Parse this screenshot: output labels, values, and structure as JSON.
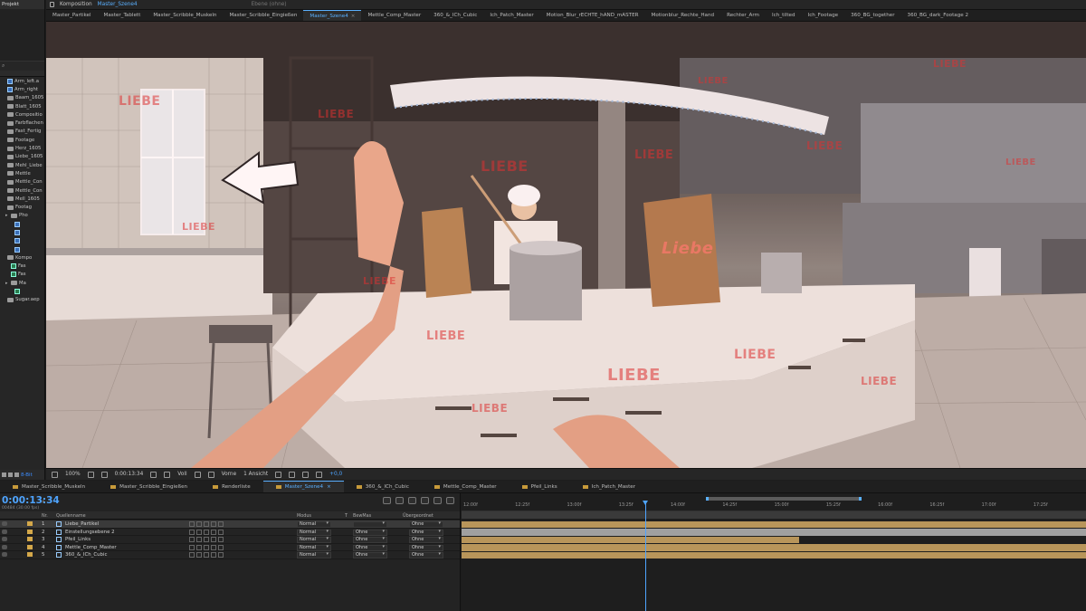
{
  "project": {
    "title": "Projekt",
    "items": [
      {
        "label": "Arm_left.a",
        "type": "footage",
        "indent": 0
      },
      {
        "label": "Arm_right",
        "type": "footage",
        "indent": 0
      },
      {
        "label": "Baam_1605",
        "type": "folder",
        "indent": 0
      },
      {
        "label": "Blatt_1605",
        "type": "folder",
        "indent": 0
      },
      {
        "label": "Compositio",
        "type": "folder",
        "indent": 0
      },
      {
        "label": "Farbflachen",
        "type": "folder",
        "indent": 0
      },
      {
        "label": "Fast_Fertig",
        "type": "folder",
        "indent": 0
      },
      {
        "label": "Footage",
        "type": "folder",
        "indent": 0
      },
      {
        "label": "Herz_1605",
        "type": "folder",
        "indent": 0
      },
      {
        "label": "Liebe_1605",
        "type": "folder",
        "indent": 0
      },
      {
        "label": "Mehl_Liebe",
        "type": "folder",
        "indent": 0
      },
      {
        "label": "Mettle",
        "type": "folder",
        "indent": 0
      },
      {
        "label": "Mettle_Con",
        "type": "folder",
        "indent": 0
      },
      {
        "label": "Mettle_Con",
        "type": "folder",
        "indent": 0
      },
      {
        "label": "Mell_1605",
        "type": "folder",
        "indent": 0
      },
      {
        "label": "Footag",
        "type": "folder",
        "indent": 0
      },
      {
        "label": "Pho",
        "type": "folder",
        "indent": 1
      },
      {
        "label": "",
        "type": "footage",
        "indent": 2
      },
      {
        "label": "",
        "type": "footage",
        "indent": 2
      },
      {
        "label": "",
        "type": "footage",
        "indent": 2
      },
      {
        "label": "",
        "type": "footage",
        "indent": 2
      },
      {
        "label": "Kompo",
        "type": "folder",
        "indent": 0
      },
      {
        "label": "Fas",
        "type": "comp",
        "indent": 1
      },
      {
        "label": "Fas",
        "type": "comp",
        "indent": 1
      },
      {
        "label": "Ma",
        "type": "folder",
        "indent": 1
      },
      {
        "label": "",
        "type": "comp",
        "indent": 2
      },
      {
        "label": "Sugar.aep",
        "type": "folder",
        "indent": 0
      }
    ],
    "footer_bpc": "8-Bit"
  },
  "comp_header": {
    "label": "Komposition",
    "name": "Master_Szene4",
    "layer_panel": "Ebene (ohne)"
  },
  "comp_tabs": [
    {
      "label": "Master_Partikel",
      "active": false
    },
    {
      "label": "Master_Tablett",
      "active": false
    },
    {
      "label": "Master_Scribble_Muskeln",
      "active": false
    },
    {
      "label": "Master_Scribble_Eingießen",
      "active": false
    },
    {
      "label": "Master_Szene4",
      "active": true
    },
    {
      "label": "Mettle_Comp_Master",
      "active": false
    },
    {
      "label": "360_&_ICh_Cubic",
      "active": false
    },
    {
      "label": "Ich_Patch_Master",
      "active": false
    },
    {
      "label": "Motion_Blur_rECHTE_hAND_mASTER",
      "active": false
    },
    {
      "label": "Motionblur_Rechte_Hand",
      "active": false
    },
    {
      "label": "Rechter_Arm",
      "active": false
    },
    {
      "label": "Ich_tilted",
      "active": false
    },
    {
      "label": "Ich_Footage",
      "active": false
    },
    {
      "label": "360_BG_together",
      "active": false
    },
    {
      "label": "360_BG_dark_Footage 2",
      "active": false
    }
  ],
  "viewer": {
    "liebe_texts": [
      "LIEBE",
      "LIEBE",
      "LIEBE",
      "LIEBE",
      "LIEBE",
      "LIEBE",
      "LIEBE",
      "LIEBE",
      "LIEBE",
      "LIEBE",
      "LIEBE",
      "LIEBE",
      "LIEBE",
      "LIEBE",
      "LIEBE"
    ],
    "bag_lettering": "Liebe"
  },
  "viewer_bar": {
    "zoom": "100%",
    "timecode": "0:00:13:34",
    "resolution": "Voll",
    "view": "Vorne",
    "views": "1 Ansicht",
    "exposure": "+0,0"
  },
  "timeline_tabs": [
    {
      "label": "Master_Scribble_Muskeln",
      "active": false
    },
    {
      "label": "Master_Scribble_Eingießen",
      "active": false
    },
    {
      "label": "Renderliste",
      "active": false
    },
    {
      "label": "Master_Szene4",
      "active": true
    },
    {
      "label": "360_&_ICh_Cubic",
      "active": false
    },
    {
      "label": "Mettle_Comp_Master",
      "active": false
    },
    {
      "label": "Pfeil_Links",
      "active": false
    },
    {
      "label": "Ich_Patch_Master",
      "active": false
    }
  ],
  "timeline": {
    "timecode": "0:00:13:34",
    "fps": "00484 (30.00 fps)",
    "columns": {
      "num": "Nr.",
      "source": "Quellenname",
      "mode": "Modus",
      "t": "T",
      "trkmat": "BewMas",
      "parent": "Übergeordnet"
    },
    "layers": [
      {
        "num": "1",
        "name": "Liebe_Partikel",
        "mode": "Normal",
        "trkmat": "",
        "parent": "Ohne",
        "label_color": "#d4a84a",
        "selected": true,
        "bar_color": "#b8955a"
      },
      {
        "num": "2",
        "name": "Einstellungsebene 2",
        "mode": "Normal",
        "trkmat": "Ohne",
        "parent": "Ohne",
        "label_color": "#d4a84a",
        "selected": false,
        "bar_color": "#a0a0a0"
      },
      {
        "num": "3",
        "name": "Pfeil_Links",
        "mode": "Normal",
        "trkmat": "Ohne",
        "parent": "Ohne",
        "label_color": "#d4a84a",
        "selected": false,
        "bar_color": "#b8955a"
      },
      {
        "num": "4",
        "name": "Mettle_Comp_Master",
        "mode": "Normal",
        "trkmat": "Ohne",
        "parent": "Ohne",
        "label_color": "#d4a84a",
        "selected": false,
        "bar_color": "#b8955a"
      },
      {
        "num": "5",
        "name": "360_&_ICh_Cubic",
        "mode": "Normal",
        "trkmat": "Ohne",
        "parent": "Ohne",
        "label_color": "#d4a84a",
        "selected": false,
        "bar_color": "#b8955a"
      }
    ],
    "ruler_labels": [
      "12:00f",
      "12:25f",
      "13:00f",
      "13:25f",
      "14:00f",
      "14:25f",
      "15:00f",
      "15:25f",
      "16:00f",
      "16:25f",
      "17:00f",
      "17:25f"
    ],
    "layer_bar_extents": [
      1.0,
      1.0,
      0.54,
      1.0,
      1.0
    ]
  }
}
